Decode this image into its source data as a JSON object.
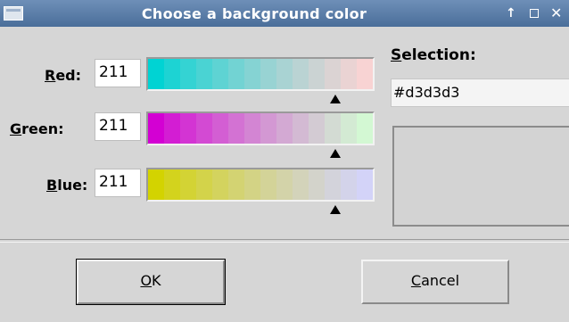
{
  "window": {
    "title": "Choose a background color",
    "icon": "window-icon",
    "controls": [
      "up-arrow-icon",
      "maximize-icon",
      "close-icon"
    ]
  },
  "channels": {
    "red": {
      "label_mnemonic": "R",
      "label_rest": "ed:",
      "value": "211",
      "gradient": [
        "#00d3d3",
        "#1dd3d3",
        "#34d3d3",
        "#4ad3d3",
        "#5ed3d3",
        "#72d3d3",
        "#85d3d3",
        "#98d3d3",
        "#a9d3d3",
        "#bad3d3",
        "#cbd3d3",
        "#dbd3d3",
        "#ead3d3",
        "#f8d3d3"
      ],
      "marker_fraction": 0.827
    },
    "green": {
      "label_mnemonic": "G",
      "label_rest": "reen:",
      "value": "211",
      "gradient": [
        "#d300d3",
        "#d31dd3",
        "#d334d3",
        "#d34ad3",
        "#d35ed3",
        "#d372d3",
        "#d385d3",
        "#d398d3",
        "#d3a9d3",
        "#d3bad3",
        "#d3cbd3",
        "#d3dbd3",
        "#d3ead3",
        "#d3f8d3"
      ],
      "marker_fraction": 0.827
    },
    "blue": {
      "label_mnemonic": "B",
      "label_rest": "lue:",
      "value": "211",
      "gradient": [
        "#d3d300",
        "#d3d31d",
        "#d3d334",
        "#d3d34a",
        "#d3d35e",
        "#d3d372",
        "#d3d385",
        "#d3d398",
        "#d3d3a9",
        "#d3d3ba",
        "#d3d3cb",
        "#d3d3db",
        "#d3d3ea",
        "#d3d3f8"
      ],
      "marker_fraction": 0.827
    }
  },
  "selection": {
    "label_mnemonic": "S",
    "label_rest": "election:",
    "value": "#d3d3d3",
    "swatch_color": "#d3d3d3"
  },
  "buttons": {
    "ok": {
      "mnemonic": "O",
      "rest": "K"
    },
    "cancel": {
      "mnemonic": "C",
      "rest": "ancel"
    }
  }
}
